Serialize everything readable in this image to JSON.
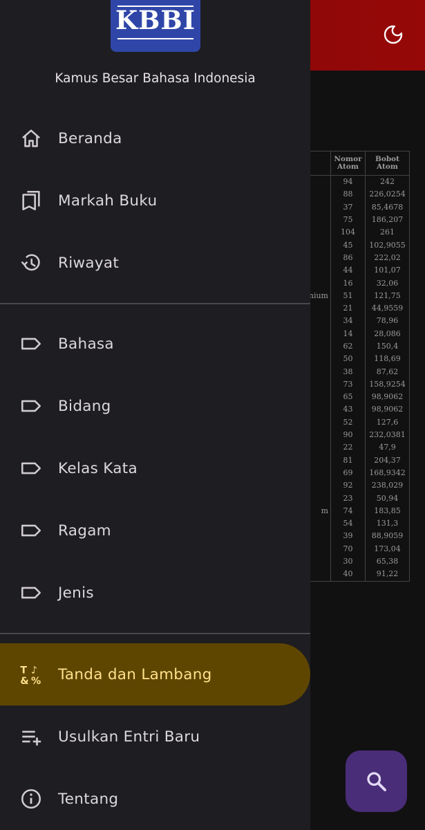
{
  "header": {
    "theme_toggle_icon": "moon-icon",
    "bar_color": "#8c0707"
  },
  "drawer": {
    "logo_text": "KBBI",
    "app_name": "Kamus Besar Bahasa Indonesia",
    "items": [
      {
        "label": "Beranda",
        "icon": "home-icon"
      },
      {
        "label": "Markah Buku",
        "icon": "bookmarks-icon"
      },
      {
        "label": "Riwayat",
        "icon": "history-icon"
      },
      {
        "label": "Bahasa",
        "icon": "label-icon"
      },
      {
        "label": "Bidang",
        "icon": "label-icon"
      },
      {
        "label": "Kelas Kata",
        "icon": "label-icon"
      },
      {
        "label": "Ragam",
        "icon": "label-icon"
      },
      {
        "label": "Jenis",
        "icon": "label-icon"
      },
      {
        "label": "Tanda dan Lambang",
        "icon": "symbols-icon",
        "active": true
      },
      {
        "label": "Usulkan Entri Baru",
        "icon": "playlist-add-icon"
      },
      {
        "label": "Tentang",
        "icon": "info-icon"
      }
    ],
    "active_color": "#5e4600",
    "active_text_color": "#ffe08c"
  },
  "background_table": {
    "headers": [
      "Nomor Atom",
      "Bobot Atom"
    ],
    "rows": [
      {
        "name": "",
        "num": "94",
        "weight": "242"
      },
      {
        "name": "",
        "num": "88",
        "weight": "226,0254"
      },
      {
        "name": "",
        "num": "37",
        "weight": "85,4678"
      },
      {
        "name": "",
        "num": "75",
        "weight": "186,207"
      },
      {
        "name": "",
        "num": "104",
        "weight": "261"
      },
      {
        "name": "",
        "num": "45",
        "weight": "102,9055"
      },
      {
        "name": "",
        "num": "86",
        "weight": "222,02"
      },
      {
        "name": "",
        "num": "44",
        "weight": "101,07"
      },
      {
        "name": "",
        "num": "16",
        "weight": "32,06"
      },
      {
        "name": "nium",
        "num": "51",
        "weight": "121,75"
      },
      {
        "name": "",
        "num": "21",
        "weight": "44,9559"
      },
      {
        "name": "",
        "num": "34",
        "weight": "78,96"
      },
      {
        "name": "",
        "num": "14",
        "weight": "28,086"
      },
      {
        "name": "",
        "num": "62",
        "weight": "150,4"
      },
      {
        "name": "",
        "num": "50",
        "weight": "118,69"
      },
      {
        "name": "",
        "num": "38",
        "weight": "87,62"
      },
      {
        "name": "",
        "num": "73",
        "weight": "158,9254"
      },
      {
        "name": "",
        "num": "65",
        "weight": "98,9062"
      },
      {
        "name": "",
        "num": "43",
        "weight": "98,9062"
      },
      {
        "name": "",
        "num": "52",
        "weight": "127,6"
      },
      {
        "name": "",
        "num": "90",
        "weight": "232,0381"
      },
      {
        "name": "",
        "num": "22",
        "weight": "47,9"
      },
      {
        "name": "",
        "num": "81",
        "weight": "204,37"
      },
      {
        "name": "",
        "num": "69",
        "weight": "168,9342"
      },
      {
        "name": "",
        "num": "92",
        "weight": "238,029"
      },
      {
        "name": "",
        "num": "23",
        "weight": "50,94"
      },
      {
        "name": "m",
        "num": "74",
        "weight": "183,85"
      },
      {
        "name": "",
        "num": "54",
        "weight": "131,3"
      },
      {
        "name": "",
        "num": "39",
        "weight": "88,9059"
      },
      {
        "name": "",
        "num": "70",
        "weight": "173,04"
      },
      {
        "name": "",
        "num": "30",
        "weight": "65,38"
      },
      {
        "name": "",
        "num": "40",
        "weight": "91,22"
      }
    ]
  },
  "fab": {
    "icon": "search-icon",
    "color": "#4a2d78"
  }
}
